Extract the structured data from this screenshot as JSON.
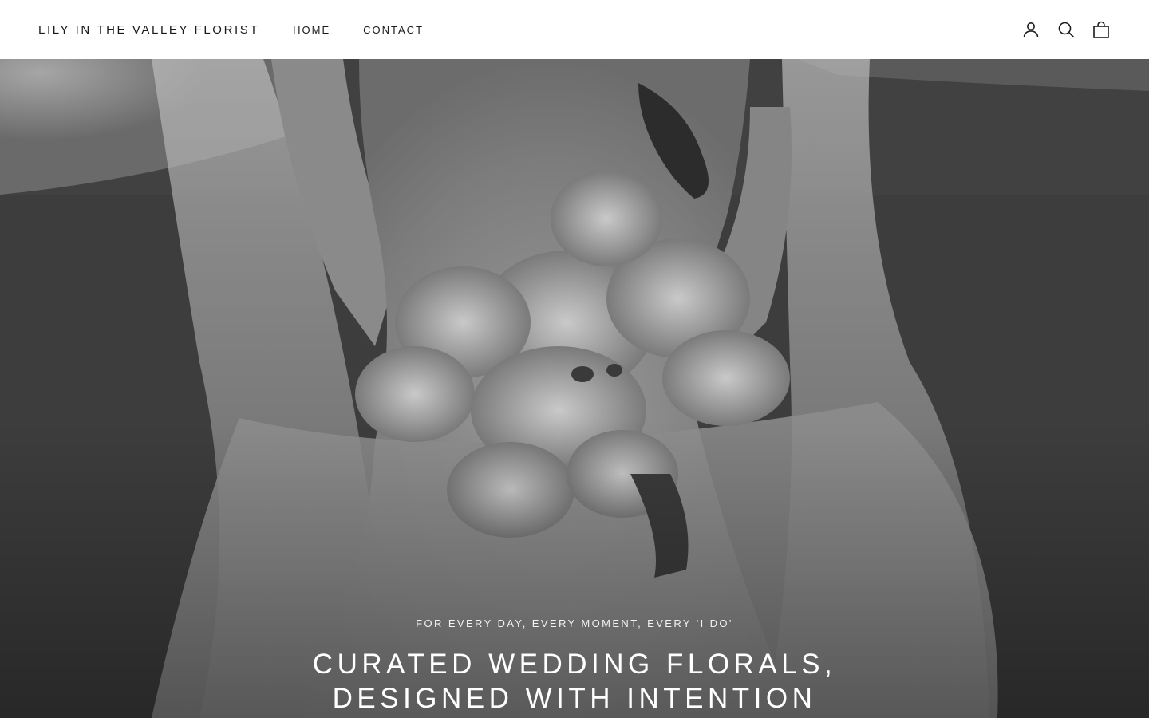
{
  "header": {
    "logo": "LILY IN THE VALLEY FLORIST",
    "nav": [
      {
        "label": "HOME"
      },
      {
        "label": "CONTACT"
      }
    ],
    "icons": [
      "account-icon",
      "search-icon",
      "cart-icon"
    ]
  },
  "hero": {
    "subheading": "FOR EVERY DAY, EVERY MOMENT, EVERY 'I DO'",
    "heading_line1": "CURATED WEDDING FLORALS,",
    "heading_line2": "DESIGNED WITH INTENTION",
    "image_alt": "Black and white photo of bride holding calla lily bouquet"
  },
  "colors": {
    "header_bg": "#ffffff",
    "text": "#1a1a1a",
    "hero_text": "#ffffff"
  }
}
